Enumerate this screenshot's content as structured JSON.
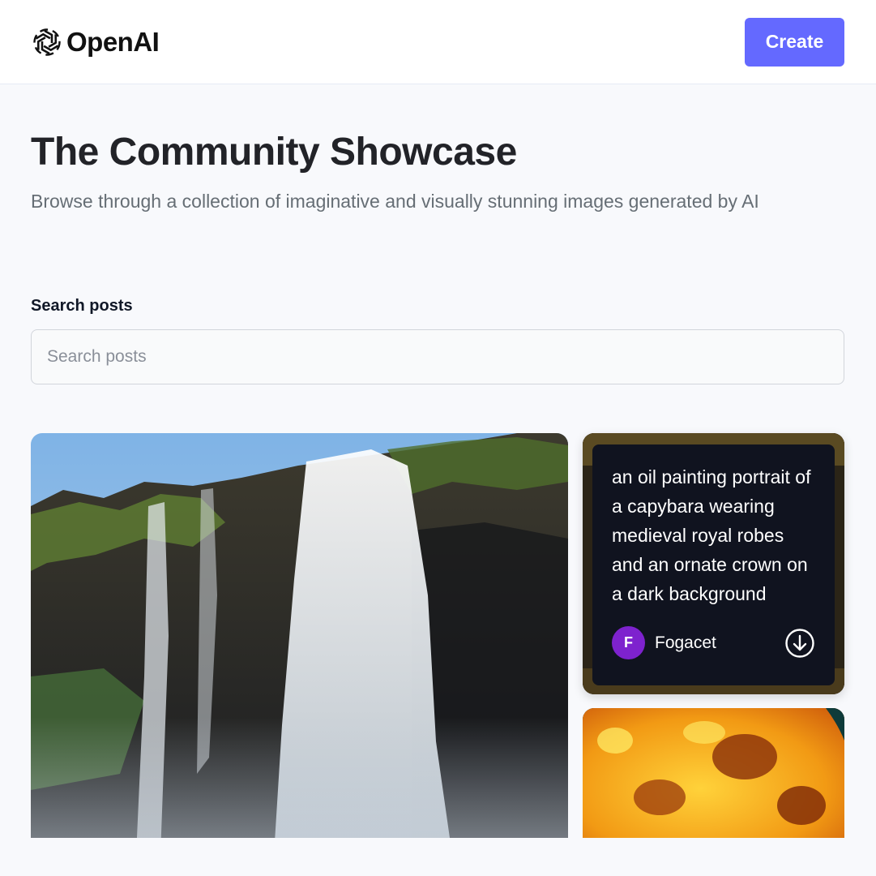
{
  "header": {
    "brand": "OpenAI",
    "create_label": "Create"
  },
  "hero": {
    "title": "The Community Showcase",
    "subtitle": "Browse through a collection of imaginative and visually stunning images generated by AI"
  },
  "search": {
    "label": "Search posts",
    "placeholder": "Search posts",
    "value": ""
  },
  "posts": [
    {
      "image": "waterfall",
      "prompt": "",
      "author": ""
    },
    {
      "image": "capybara-portrait",
      "prompt": "an oil painting portrait of a capybara wearing medieval royal robes and an ornate crown on a dark background",
      "author": "Fogacet",
      "avatar_initial": "F",
      "avatar_color": "#7e22ce",
      "download_icon": "download-icon"
    },
    {
      "image": "sun-surface",
      "prompt": "",
      "author": ""
    }
  ],
  "colors": {
    "accent": "#6469ff",
    "background": "#f8f9fc",
    "hover_panel": "#10131f"
  }
}
